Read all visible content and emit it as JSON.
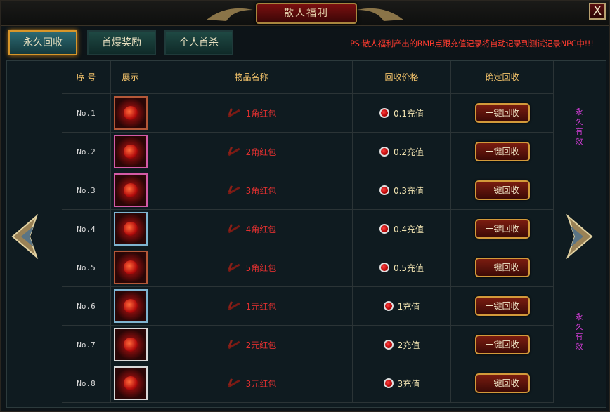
{
  "title": "散人福利",
  "close_icon_label": "X",
  "tabs": [
    {
      "label": "永久回收"
    },
    {
      "label": "首爆奖励"
    },
    {
      "label": "个人首杀"
    }
  ],
  "notice": "PS:散人福利产出的RMB点跟充值记录将自动记录到测试记录NPC中!!!",
  "headers": [
    "序 号",
    "展示",
    "物品名称",
    "回收价格",
    "确定回收"
  ],
  "rows": [
    {
      "no": "No.1",
      "name": "1角红包",
      "price": "0.1充值",
      "button": "一键回收"
    },
    {
      "no": "No.2",
      "name": "2角红包",
      "price": "0.2充值",
      "button": "一键回收"
    },
    {
      "no": "No.3",
      "name": "3角红包",
      "price": "0.3充值",
      "button": "一键回收"
    },
    {
      "no": "No.4",
      "name": "4角红包",
      "price": "0.4充值",
      "button": "一键回收"
    },
    {
      "no": "No.5",
      "name": "5角红包",
      "price": "0.5充值",
      "button": "一键回收"
    },
    {
      "no": "No.6",
      "name": "1元红包",
      "price": "1充值",
      "button": "一键回收"
    },
    {
      "no": "No.7",
      "name": "2元红包",
      "price": "2充值",
      "button": "一键回收"
    },
    {
      "no": "No.8",
      "name": "3元红包",
      "price": "3充值",
      "button": "一键回收"
    }
  ],
  "side_labels": [
    "永久有效",
    "永久有效"
  ],
  "icons": {
    "close": "close-icon",
    "prev": "left-arrow-icon",
    "next": "right-arrow-icon",
    "item": "red-envelope-icon",
    "item_mark": "fire-mark-icon",
    "price": "currency-dot-icon"
  },
  "colors": {
    "accent": "#d39a3a",
    "item_name": "#e03030",
    "notice": "#ff3b2f",
    "header": "#f2c26a",
    "side": "#d43cd8"
  }
}
